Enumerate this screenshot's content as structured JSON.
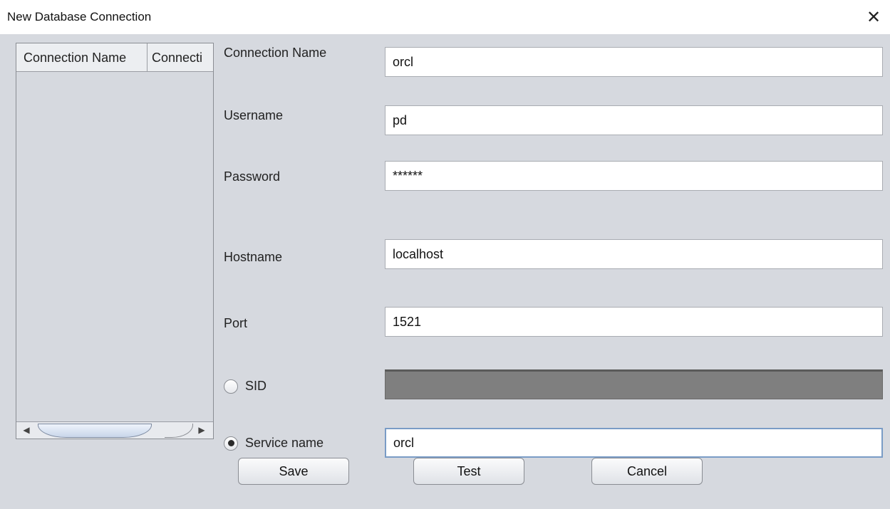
{
  "window": {
    "title": "New Database Connection",
    "close_glyph": "✕"
  },
  "table": {
    "columns": [
      "Connection Name",
      "Connecti"
    ],
    "rows": [],
    "scroll_left_glyph": "◀",
    "scroll_right_glyph": "▶"
  },
  "form": {
    "connection_name": {
      "label": "Connection Name",
      "value": "orcl"
    },
    "username": {
      "label": "Username",
      "value": "pd"
    },
    "password": {
      "label": "Password",
      "value": "******"
    },
    "hostname": {
      "label": "Hostname",
      "value": "localhost"
    },
    "port": {
      "label": "Port",
      "value": "1521"
    },
    "sid": {
      "label": "SID",
      "value": "",
      "selected": false
    },
    "service_name": {
      "label": "Service name",
      "value": "orcl",
      "selected": true
    }
  },
  "buttons": {
    "save": "Save",
    "test": "Test",
    "cancel": "Cancel"
  },
  "colors": {
    "client_bg": "#d6d9df",
    "disabled_field": "#7f7f7f",
    "focus_border": "#7a9cc6"
  }
}
